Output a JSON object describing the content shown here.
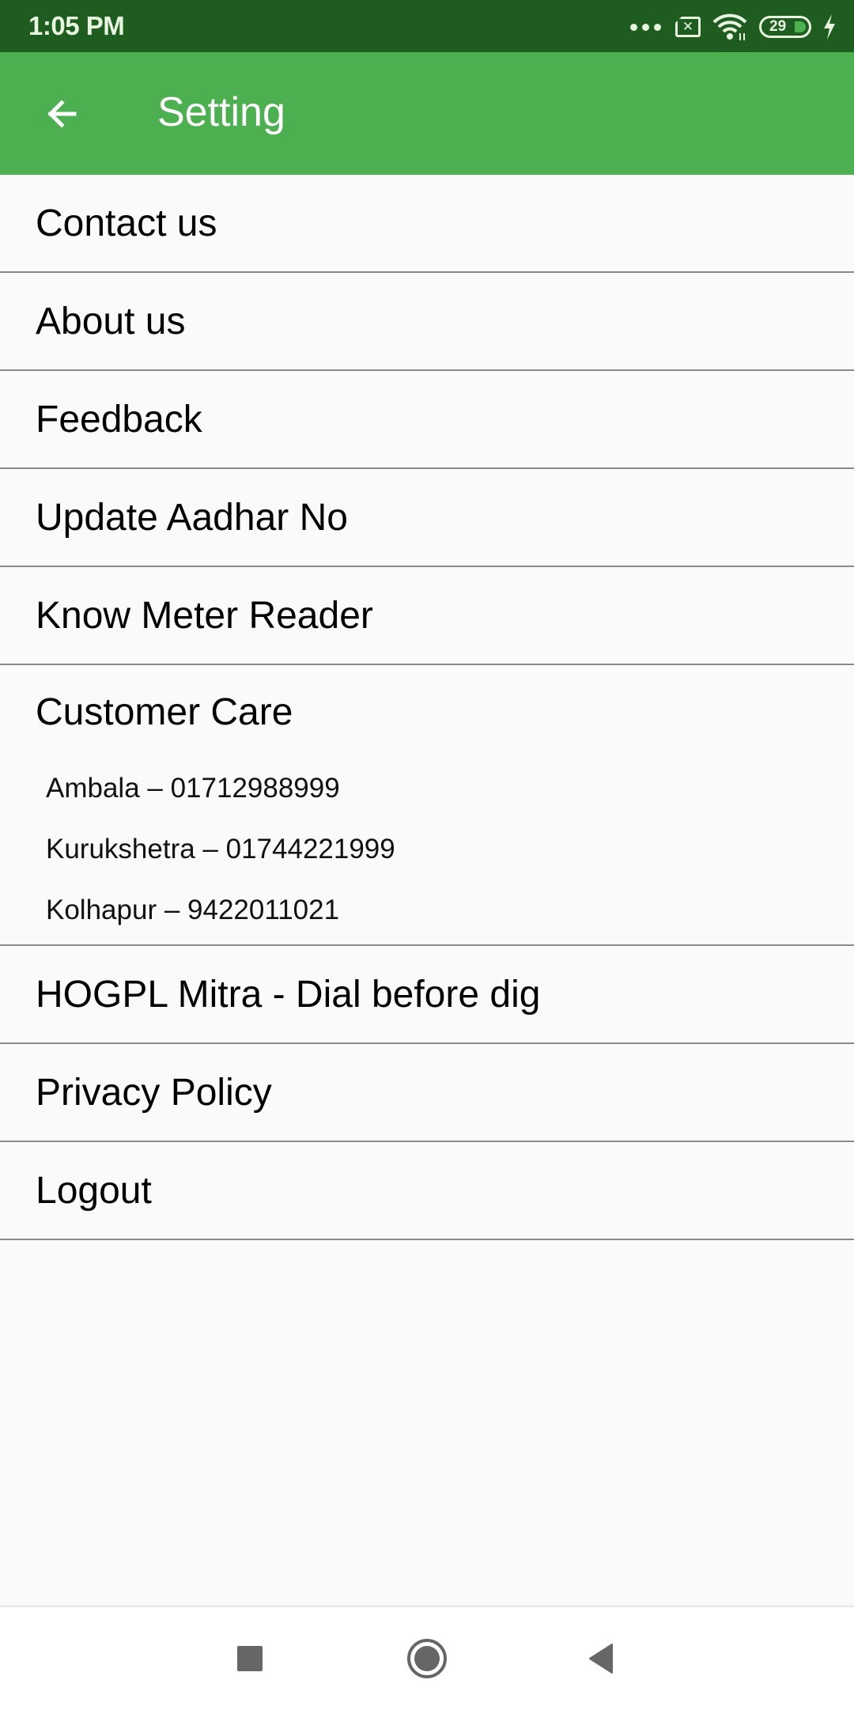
{
  "status_bar": {
    "time": "1:05 PM",
    "battery_level": "29",
    "icons": [
      "more-dots-icon",
      "no-sim-icon",
      "wifi-icon",
      "battery-icon",
      "charging-bolt-icon"
    ]
  },
  "app_bar": {
    "title": "Setting",
    "back_icon": "arrow-back-icon",
    "background": "#4caf50"
  },
  "menu": {
    "items": [
      {
        "label": "Contact us"
      },
      {
        "label": "About us"
      },
      {
        "label": "Feedback"
      },
      {
        "label": "Update Aadhar No"
      },
      {
        "label": "Know Meter Reader"
      }
    ],
    "customer_care": {
      "title": "Customer Care",
      "lines": [
        {
          "text": "Ambala – 01712988999"
        },
        {
          "text": "Kurukshetra – 01744221999"
        },
        {
          "text": "Kolhapur – 9422011021"
        }
      ]
    },
    "items_after": [
      {
        "label": "HOGPL Mitra - Dial before dig"
      },
      {
        "label": "Privacy Policy"
      },
      {
        "label": "Logout"
      }
    ]
  },
  "nav_bar": {
    "buttons": [
      "recents-icon",
      "home-icon",
      "back-icon"
    ]
  }
}
